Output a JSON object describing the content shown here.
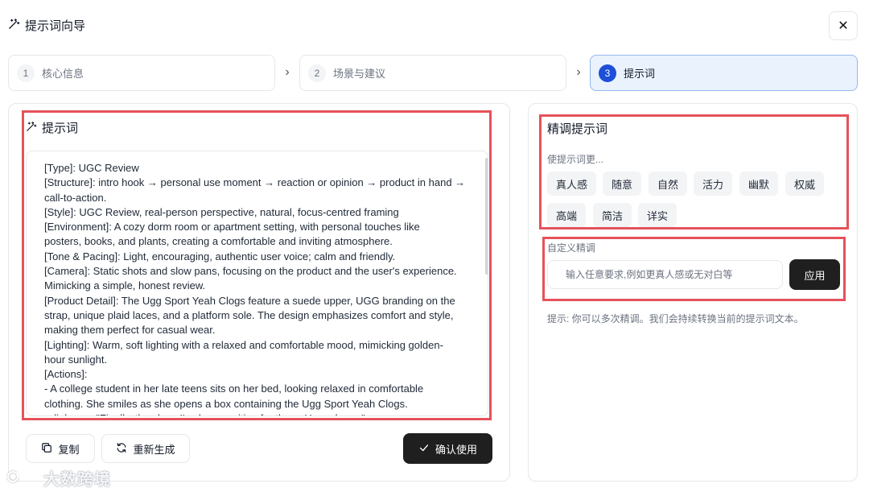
{
  "header": {
    "title": "提示词向导",
    "title_icon": "magic-wand-icon",
    "close_icon": "close-icon"
  },
  "steps": [
    {
      "num": "1",
      "label": "核心信息",
      "active": false
    },
    {
      "num": "2",
      "label": "场景与建议",
      "active": false
    },
    {
      "num": "3",
      "label": "提示词",
      "active": true
    }
  ],
  "prompt": {
    "label": "提示词",
    "text": "[Type]: UGC Review\n[Structure]: intro hook → personal use moment → reaction or opinion → product in hand →\ncall-to-action.\n[Style]: UGC Review, real-person perspective, natural, focus-centred framing\n[Environment]: A cozy dorm room or apartment setting, with personal touches like\nposters, books, and plants, creating a comfortable and inviting atmosphere.\n[Tone & Pacing]: Light, encouraging, authentic user voice; calm and friendly.\n[Camera]: Static shots and slow pans, focusing on the product and the user's experience.\nMimicking a simple, honest review.\n[Product Detail]: The Ugg Sport Yeah Clogs feature a suede upper, UGG branding on the\nstrap, unique plaid laces, and a platform sole. The design emphasizes comfort and style,\nmaking them perfect for casual wear.\n[Lighting]: Warm, soft lighting with a relaxed and comfortable mood, mimicking golden-\nhour sunlight.\n[Actions]:\n- A college student in her late teens sits on her bed, looking relaxed in comfortable\nclothing. She smiles as she opens a box containing the Ugg Sport Yeah Clogs.\n- dialogue: \"Finally, the clogs I've been waiting for them. Hmm, hmm.\""
  },
  "actions": {
    "copy": "复制",
    "regenerate": "重新生成",
    "confirm": "确认使用"
  },
  "refine": {
    "title": "精调提示词",
    "subtitle": "使提示词更...",
    "chips": [
      "真人感",
      "随意",
      "自然",
      "活力",
      "幽默",
      "权威",
      "高端",
      "简洁",
      "详实"
    ]
  },
  "custom": {
    "label": "自定义精调",
    "placeholder": "输入任意要求,例如更真人感或无对白等",
    "apply": "应用",
    "tip": "提示: 你可以多次精调。我们会持续转换当前的提示词文本。"
  },
  "watermark": {
    "text": "大数跨境"
  },
  "colors": {
    "accent": "#1d4ed8",
    "highlight": "#e5525a",
    "dark_button": "#1f1f1f"
  }
}
